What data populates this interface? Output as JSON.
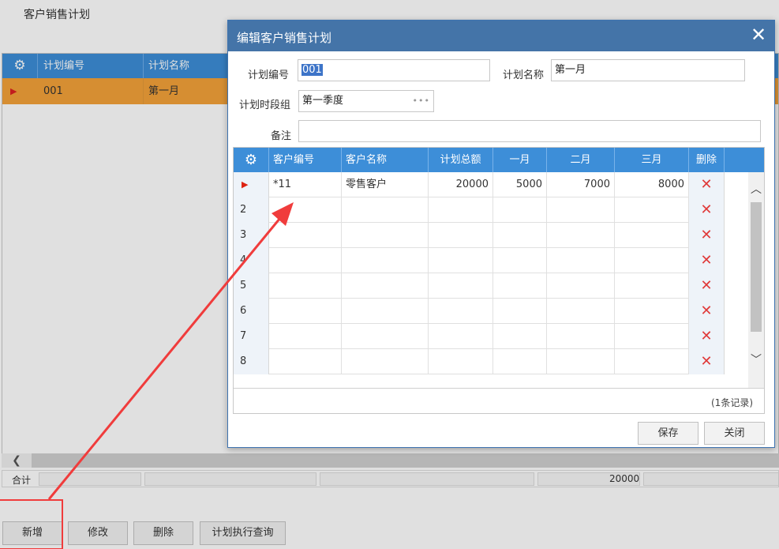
{
  "background": {
    "page_title": "客户销售计划",
    "grid": {
      "gear_icon": "gear-icon",
      "columns": [
        "计划编号",
        "计划名称"
      ],
      "rows": [
        {
          "plan_no": "001",
          "plan_name": "第一月"
        }
      ]
    },
    "total": {
      "label": "合计",
      "value": "20000"
    },
    "buttons": {
      "add": "新增",
      "edit": "修改",
      "delete": "删除",
      "query": "计划执行查询"
    }
  },
  "dialog": {
    "title": "编辑客户销售计划",
    "form": {
      "plan_no_label": "计划编号",
      "plan_no_value": "001",
      "plan_name_label": "计划名称",
      "plan_name_value": "第一月",
      "period_group_label": "计划时段组",
      "period_group_value": "第一季度",
      "remark_label": "备注",
      "remark_value": ""
    },
    "grid": {
      "columns": [
        "客户编号",
        "客户名称",
        "计划总额",
        "一月",
        "二月",
        "三月",
        "删除"
      ],
      "rows": [
        {
          "rn": "",
          "customer_no": "*11",
          "customer_name": "零售客户",
          "total": "20000",
          "m1": "5000",
          "m2": "7000",
          "m3": "8000"
        },
        {
          "rn": "2",
          "customer_no": "",
          "customer_name": "",
          "total": "",
          "m1": "",
          "m2": "",
          "m3": ""
        },
        {
          "rn": "3",
          "customer_no": "",
          "customer_name": "",
          "total": "",
          "m1": "",
          "m2": "",
          "m3": ""
        },
        {
          "rn": "4",
          "customer_no": "",
          "customer_name": "",
          "total": "",
          "m1": "",
          "m2": "",
          "m3": ""
        },
        {
          "rn": "5",
          "customer_no": "",
          "customer_name": "",
          "total": "",
          "m1": "",
          "m2": "",
          "m3": ""
        },
        {
          "rn": "6",
          "customer_no": "",
          "customer_name": "",
          "total": "",
          "m1": "",
          "m2": "",
          "m3": ""
        },
        {
          "rn": "7",
          "customer_no": "",
          "customer_name": "",
          "total": "",
          "m1": "",
          "m2": "",
          "m3": ""
        },
        {
          "rn": "8",
          "customer_no": "",
          "customer_name": "",
          "total": "",
          "m1": "",
          "m2": "",
          "m3": ""
        }
      ],
      "record_count": "(1条记录)"
    },
    "buttons": {
      "save": "保存",
      "close": "关闭"
    }
  },
  "colors": {
    "header_blue": "#3d8ed8",
    "title_blue": "#4474a8",
    "selected_row": "#f4a23a",
    "annotation_red": "#f03c3c"
  }
}
